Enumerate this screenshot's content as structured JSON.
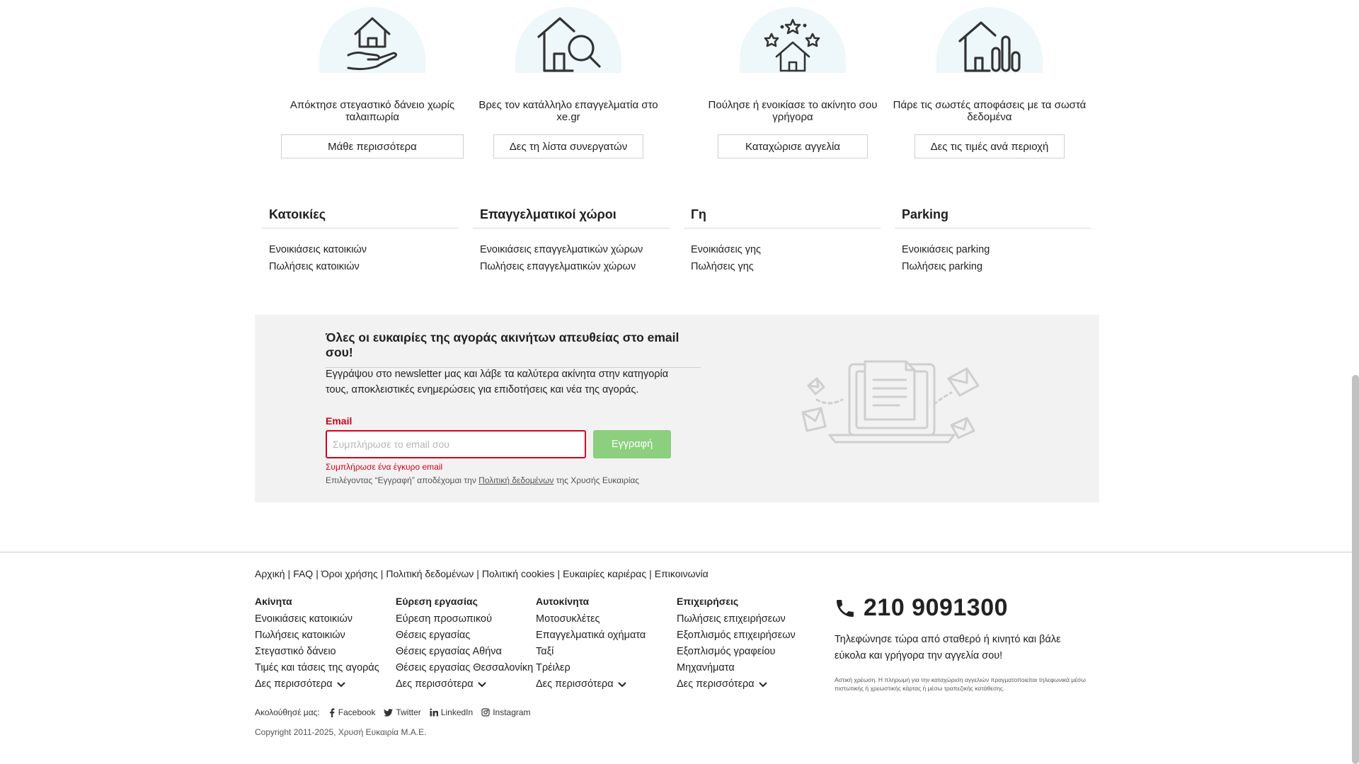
{
  "features": [
    {
      "text": "Απόκτησε στεγαστικό δάνειο χωρίς ταλαιπωρία",
      "button": "Μάθε περισσότερα",
      "icon": "house-in-hand-icon"
    },
    {
      "text": "Βρες τον κατάλληλο επαγγελματία στο xe.gr",
      "button": "Δες τη λίστα συνεργατών",
      "icon": "house-search-icon"
    },
    {
      "text": "Πούλησε ή ενοικίασε το ακίνητο σου γρήγορα",
      "button": "Καταχώρισε αγγελία",
      "icon": "house-stars-icon"
    },
    {
      "text": "Πάρε τις σωστές αποφάσεις με τα σωστά δεδομένα",
      "button": "Δες τις τιμές ανά περιοχή",
      "icon": "house-chart-icon"
    }
  ],
  "categories": [
    {
      "title": "Κατοικίες",
      "links": [
        "Ενοικιάσεις κατοικιών",
        "Πωλήσεις κατοικιών"
      ]
    },
    {
      "title": "Επαγγελματικοί χώροι",
      "links": [
        "Ενοικιάσεις επαγγελματικών χώρων",
        "Πωλήσεις επαγγελματικών χώρων"
      ]
    },
    {
      "title": "Γη",
      "links": [
        "Ενοικιάσεις γης",
        "Πωλήσεις γης"
      ]
    },
    {
      "title": "Parking",
      "links": [
        "Ενοικιάσεις parking",
        "Πωλήσεις parking"
      ]
    }
  ],
  "newsletter": {
    "title": "Όλες οι ευκαιρίες της αγοράς ακινήτων απευθείας στο email σου!",
    "description": "Εγγράψου στο newsletter μας και λάβε τα καλύτερα ακίνητα στην κατηγορία τους, αποκλειστικές ενημερώσεις για επιδοτήσεις και νέα της αγοράς.",
    "email_label": "Email",
    "email_placeholder": "Συμπλήρωσε το email σου",
    "email_value": "",
    "submit_label": "Εγγραφή",
    "error": "Συμπλήρωσε ένα έγκυρο email",
    "legal_prefix": "Επιλέγοντας “Εγγραφή” αποδέχομαι την",
    "legal_link": "Πολιτική δεδομένων",
    "legal_suffix": "της Χρυσής Ευκαιρίας",
    "illustration_icon": "laptop-newsletter-envelopes-icon"
  },
  "footer": {
    "top_links": [
      "Αρχική",
      "FAQ",
      "Όροι χρήσης",
      "Πολιτική δεδομένων",
      "Πολιτική cookies",
      "Ευκαιρίες καριέρας",
      "Επικοινωνία"
    ],
    "columns": [
      {
        "title": "Ακίνητα",
        "links": [
          "Ενοικιάσεις κατοικιών",
          "Πωλήσεις κατοικιών",
          "Στεγαστικό δάνειο",
          "Τιμές και τάσεις της αγοράς"
        ],
        "more": "Δες περισσότερα"
      },
      {
        "title": "Εύρεση εργασίας",
        "links": [
          "Εύρεση προσωπικού",
          "Θέσεις εργασίας",
          "Θέσεις εργασίας Αθήνα",
          "Θέσεις εργασίας Θεσσαλονίκη"
        ],
        "more": "Δες περισσότερα"
      },
      {
        "title": "Αυτοκίνητα",
        "links": [
          "Μοτοσυκλέτες",
          "Επαγγελματικά οχήματα",
          "Ταξί",
          "Τρέιλερ"
        ],
        "more": "Δες περισσότερα"
      },
      {
        "title": "Επιχειρήσεις",
        "links": [
          "Πωλήσεις επιχειρήσεων",
          "Εξοπλισμός επιχειρήσεων",
          "Εξοπλισμός γραφείου",
          "Μηχανήματα"
        ],
        "more": "Δες περισσότερα"
      }
    ],
    "phone": "210 9091300",
    "phone_text": "Τηλεφώνησε τώρα από σταθερό ή κινητό και βάλε εύκολα και γρήγορα την αγγελία σου!",
    "phone_note": "Αστική χρέωση. Η πληρωμή για την καταχώριση αγγελιών πραγματοποιείται τηλεφωνικά μέσω πιστωτικής ή χρεωστικής κάρτας ή μέσω τραπεζικής κατάθεσης.",
    "follow_label": "Ακολούθησέ μας:",
    "social": [
      {
        "label": "Facebook",
        "icon": "facebook-icon"
      },
      {
        "label": "Twitter",
        "icon": "twitter-icon"
      },
      {
        "label": "LinkedIn",
        "icon": "linkedin-icon"
      },
      {
        "label": "Instagram",
        "icon": "instagram-icon"
      }
    ],
    "copyright": "Copyright 2011-2025, Χρυσή Ευκαιρία Μ.Α.Ε."
  },
  "colors": {
    "accent_green": "#8ccf7e",
    "error_red": "#d0021b",
    "icon_bg": "#eef7f9",
    "newsletter_bg": "#f2f2f2"
  }
}
